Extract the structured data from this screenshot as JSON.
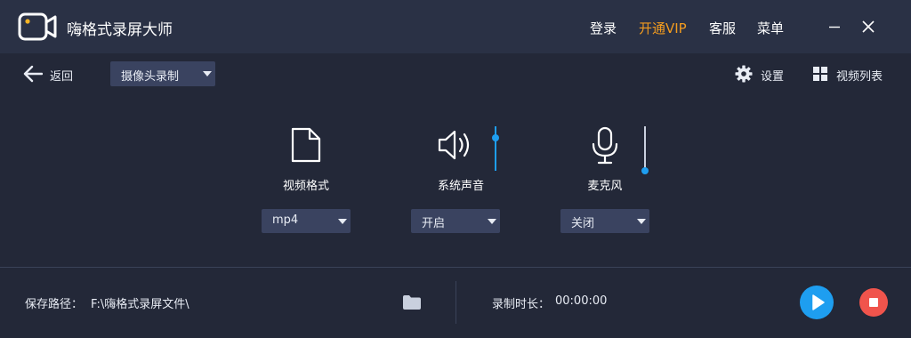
{
  "app": {
    "title": "嗨格式录屏大师",
    "accent_color": "#1e9ef0",
    "vip_color": "#f39c1f",
    "record_color": "#f0544c"
  },
  "titlebar": {
    "login": "登录",
    "vip": "开通VIP",
    "support": "客服",
    "menu": "菜单",
    "minimize_icon": "minimize-icon",
    "close_icon": "close-icon"
  },
  "toolbar": {
    "back_label": "返回",
    "mode_selected": "摄像头录制",
    "settings_label": "设置",
    "video_list_label": "视频列表"
  },
  "options": {
    "video_format": {
      "label": "视频格式",
      "selected": "mp4",
      "icon": "file-icon"
    },
    "system_sound": {
      "label": "系统声音",
      "selected": "开启",
      "icon": "speaker-icon",
      "volume_percent": 100
    },
    "microphone": {
      "label": "麦克风",
      "selected": "关闭",
      "icon": "microphone-icon",
      "volume_percent": 0
    }
  },
  "footer": {
    "save_path_label": "保存路径：",
    "save_path_value": "F:\\嗨格式录屏文件\\",
    "duration_label": "录制时长：",
    "duration_value": "00:00:00"
  }
}
